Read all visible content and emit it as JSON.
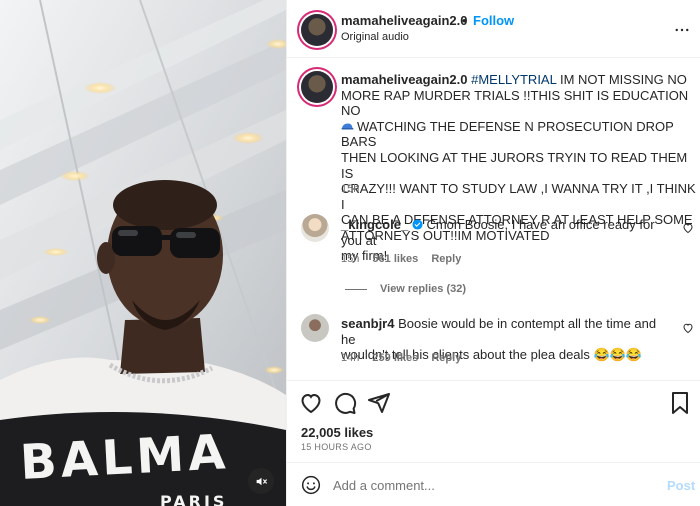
{
  "header": {
    "username": "mamaheliveagain2.0",
    "dot": "•",
    "follow_label": "Follow",
    "audio": "Original audio",
    "more_icon": "more-horizontal-icon"
  },
  "caption": {
    "username": "mamaheliveagain2.0",
    "hashtag": "#MELLYTRIAL",
    "line1_rest": " IM NOT MISSING NO",
    "line2": "MORE RAP MURDER TRIALS !!THIS SHIT IS EDUCATION NO",
    "line3": "WATCHING THE DEFENSE N PROSECUTION DROP BARS",
    "line4": "THEN LOOKING AT THE JURORS TRYIN TO READ THEM IS",
    "line5": "CRAZY!!! WANT TO STUDY LAW ,I WANNA TRY IT ,I THINK I",
    "line6": "CAN BE A DEFENSE ATTORNEY R AT LEAST HELP SOME",
    "line7": "ATTORNEYS OUT!!IM MOTIVATED",
    "time": "15h"
  },
  "comments": [
    {
      "username": "_kingcole_",
      "verified": true,
      "text_line1": "Cmon Boosie, I have an office ready for you at",
      "text_line2": "my firm!",
      "time": "15h",
      "likes": "561 likes",
      "reply": "Reply",
      "view_replies": "View replies (32)"
    },
    {
      "username": "seanbjr4",
      "text_line1": "Boosie would be in contempt all the time and he",
      "text_line2": "wouldn't tell his clients about the plea deals 😂😂😂",
      "time": "14h",
      "likes": "259 likes",
      "reply": "Reply"
    }
  ],
  "post": {
    "likes": "22,005 likes",
    "age": "15 HOURS AGO"
  },
  "composer": {
    "placeholder": "Add a comment...",
    "post_label": "Post"
  },
  "media": {
    "shirt_text_1": "BALMA",
    "shirt_text_2": "PARIS",
    "mute_icon": "speaker-muted-icon"
  },
  "colors": {
    "accent": "#0095f6",
    "text": "#262626",
    "muted": "#737373",
    "divider": "#efefef"
  }
}
